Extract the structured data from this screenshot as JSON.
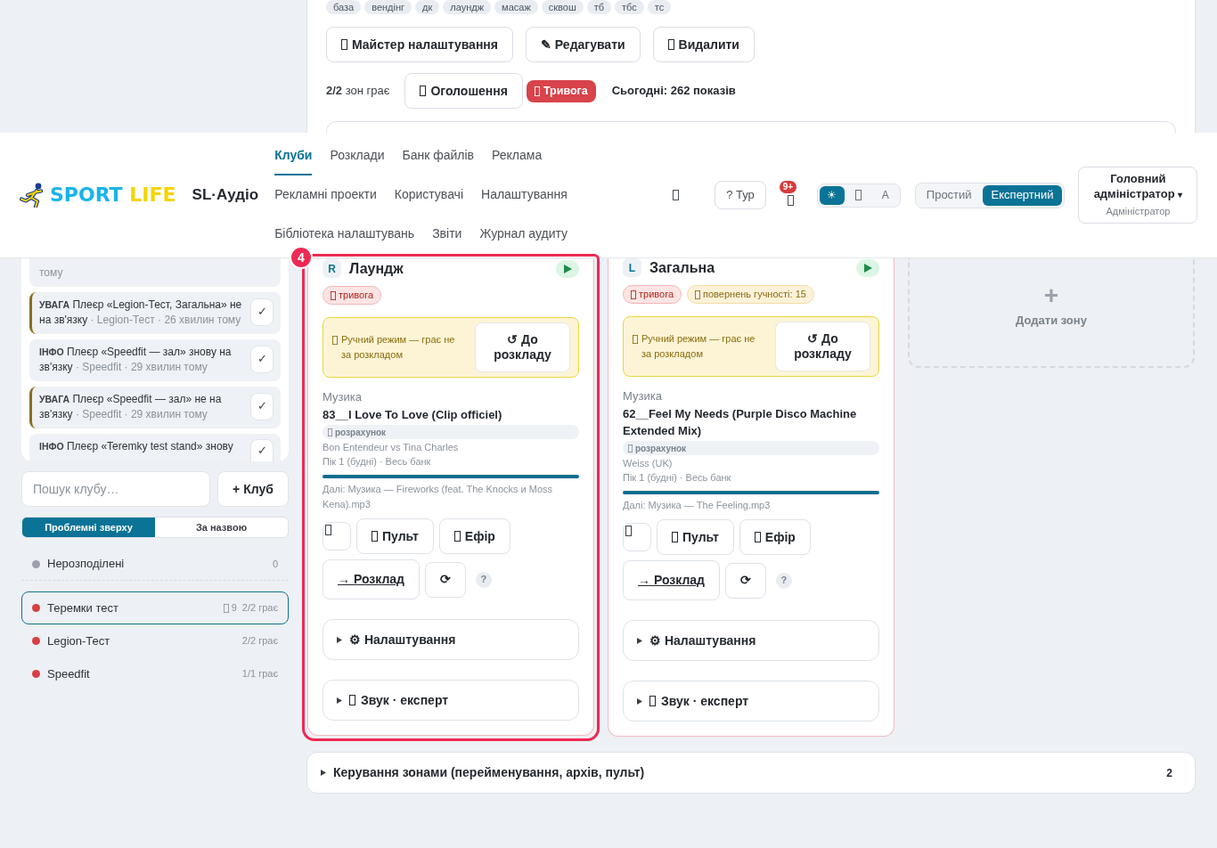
{
  "club_panel": {
    "tags": [
      "база",
      "вендінг",
      "дк",
      "лаундж",
      "масаж",
      "сквош",
      "тб",
      "тбс",
      "тс"
    ],
    "actions": [
      {
        "kind": "icon",
        "label": "Майстер налаштування"
      },
      {
        "kind": "plain",
        "label": "✎ Редагувати"
      },
      {
        "kind": "icon",
        "label": "Видалити"
      }
    ],
    "zones_playing": "**2/2** зон грає",
    "announce_button": "Оголошення",
    "alarm_button": "Тривога",
    "today": "Сьогодні: 262 показів"
  },
  "header": {
    "logo": [
      {
        "word": "SPORT",
        "color": "#19b4ea"
      },
      {
        "word": "LIFE",
        "color": "#f5d400"
      }
    ],
    "app_name": "SL·Аудіо",
    "nav": [
      {
        "label": "Клуби",
        "selected": true
      },
      {
        "label": "Розклади",
        "selected": false
      },
      {
        "label": "Банк файлів",
        "selected": false
      },
      {
        "label": "Реклама",
        "selected": false
      },
      {
        "label": "Рекламні проекти",
        "selected": false
      },
      {
        "label": "Користувачі",
        "selected": false
      },
      {
        "label": "Налаштування",
        "selected": false
      },
      {
        "label": "Бібліотека налаштувань",
        "selected": false
      },
      {
        "label": "Звіти",
        "selected": false
      },
      {
        "label": "Журнал аудиту",
        "selected": false
      }
    ],
    "tour_button": "? Тур",
    "notification_count": "9+",
    "theme": [
      {
        "kind": "text",
        "label": "☀",
        "selected": true
      },
      {
        "kind": "icon",
        "selected": false
      },
      {
        "kind": "text",
        "label": "A",
        "selected": false
      }
    ],
    "mode": [
      {
        "label": "Простий",
        "selected": false
      },
      {
        "label": "Експертний",
        "selected": true
      }
    ],
    "user": {
      "name": "Головний адміністратор",
      "caret": "▾",
      "role": "Адміністратор"
    }
  },
  "notifications": [
    {
      "kind": "info",
      "meta": "тому"
    },
    {
      "kind": "warning",
      "tag": "УВАГА",
      "message": "Плеєр «Legion-Тест, Загальна» не на зв'язку",
      "meta": "· Legion-Тест · 26 хвилин тому",
      "check": "✓"
    },
    {
      "kind": "info",
      "tag": "ІНФО",
      "message": "Плеєр «Speedfit — зал» знову на зв'язку",
      "meta": "· Speedfit · 29 хвилин тому",
      "check": "✓"
    },
    {
      "kind": "warning",
      "tag": "УВАГА",
      "message": "Плеєр «Speedfit — зал» не на зв'язку",
      "meta": "· Speedfit · 29 хвилин тому",
      "check": "✓"
    },
    {
      "kind": "info",
      "tag": "ІНФО",
      "message": "Плеєр «Teremky test stand» знову",
      "check": "✓"
    }
  ],
  "club_search": {
    "placeholder": "Пошук клубу…"
  },
  "add_club_button": "+ Клуб",
  "sort": [
    {
      "label": "Проблемні зверху",
      "selected": true
    },
    {
      "label": "За назвою",
      "selected": false
    }
  ],
  "clubs": [
    {
      "kind": "unassigned",
      "name": "Нерозподілені",
      "color": "#9aa1ab",
      "count": "0",
      "selected": false
    },
    {
      "kind": "club",
      "name": "Теремки тест",
      "color": "#d64045",
      "alerts": "9",
      "playing": "2/2 грає",
      "selected": true
    },
    {
      "kind": "club",
      "name": "Legion-Тест",
      "color": "#d64045",
      "playing": "2/2 грає",
      "selected": false
    },
    {
      "kind": "club",
      "name": "Speedfit",
      "color": "#d64045",
      "playing": "1/1 грає",
      "selected": false
    }
  ],
  "zones": [
    {
      "badge": "R",
      "name": "Лаундж",
      "alarm": true,
      "highlighted": true,
      "step": "4",
      "tags": [
        {
          "kind": "alarm",
          "label": "тривога"
        }
      ],
      "manual_mode": {
        "text": "Ручний режим — грає не за розкладом",
        "button": "↺ До розкладу"
      },
      "category": "Музика",
      "track": "83__I Love To Love (Clip officiel)",
      "status_pill": "розрахунок",
      "artist": "Bon Entendeur vs Tina Charles",
      "source": "Пік 1 (будні) · Весь банк",
      "progress": {
        "level": 1
      },
      "next": "Далі: Музика — Fireworks (feat. The Knocks и Moss Kena).mp3",
      "controls": [
        {
          "kind": "icon",
          "label": "Пульт"
        },
        {
          "kind": "icon",
          "label": "Ефір"
        }
      ],
      "schedule_button": "→ Розклад",
      "refresh_button": "⟳",
      "help": "?",
      "sections": [
        {
          "kind": "plain",
          "label": "⚙ Налаштування"
        },
        {
          "kind": "icon",
          "label": "Звук · експерт"
        }
      ]
    },
    {
      "badge": "L",
      "name": "Загальна",
      "alarm": true,
      "highlighted": false,
      "tags": [
        {
          "kind": "alarm",
          "label": "тривога"
        },
        {
          "kind": "warning",
          "label": "повернень гучності: 15"
        }
      ],
      "manual_mode": {
        "text": "Ручний режим — грає не за розкладом",
        "button": "↺ До розкладу"
      },
      "category": "Музика",
      "track": "62__Feel My Needs (Purple Disco Machine Extended Mix)",
      "status_pill": "розрахунок",
      "artist": "Weiss (UK)",
      "source": "Пік 1 (будні) · Весь банк",
      "progress": {
        "level": 1
      },
      "next": "Далі: Музика — The Feeling.mp3",
      "controls": [
        {
          "kind": "icon",
          "label": "Пульт"
        },
        {
          "kind": "icon",
          "label": "Ефір"
        }
      ],
      "schedule_button": "→ Розклад",
      "refresh_button": "⟳",
      "help": "?",
      "sections": [
        {
          "kind": "plain",
          "label": "⚙ Налаштування"
        },
        {
          "kind": "icon",
          "label": "Звук · експерт"
        }
      ]
    }
  ],
  "add_zone": {
    "plus": "+",
    "label": "Додати зону"
  },
  "zone_management": {
    "label": "Керування зонами (перейменування, архів, пульт)",
    "count": "2"
  }
}
